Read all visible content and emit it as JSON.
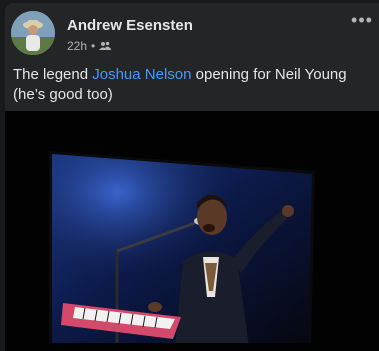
{
  "post": {
    "author": "Andrew Esensten",
    "time": "22h",
    "separator": "•",
    "text_before": "The legend ",
    "text_link": "Joshua Nelson",
    "text_after": " opening for Neil Young (he’s good too)"
  },
  "icons": {
    "more": "more-options-icon",
    "audience": "friends-audience-icon"
  },
  "colors": {
    "background": "#18191a",
    "card": "#242526",
    "text": "#e4e6eb",
    "secondary_text": "#b0b3b8",
    "link": "#4599ff"
  }
}
